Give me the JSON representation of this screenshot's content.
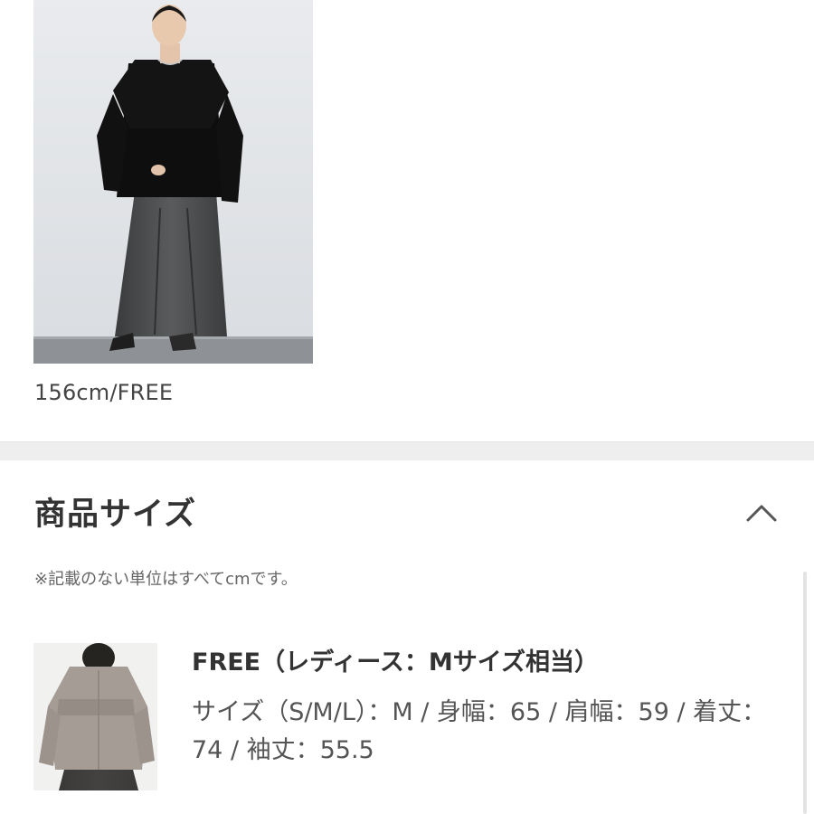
{
  "model": {
    "image_alt": "model wearing black layered top and grey maxi skirt",
    "caption": "156cm/FREE"
  },
  "size_section": {
    "heading": "商品サイズ",
    "toggle_icon": "chevron-up-icon",
    "note": "※記載のない単位はすべてcmです。",
    "items": [
      {
        "thumbnail_alt": "greige layered top back view",
        "title": "FREE（レディース：Mサイズ相当）",
        "detail": "サイズ（S/M/L）：M / 身幅：65 / 肩幅：59 / 着丈：74 / 袖丈：55.5"
      }
    ]
  },
  "colors": {
    "divider": "#eeeeee",
    "heading_text": "#333333",
    "body_text": "#555555",
    "note_text": "#666666"
  }
}
